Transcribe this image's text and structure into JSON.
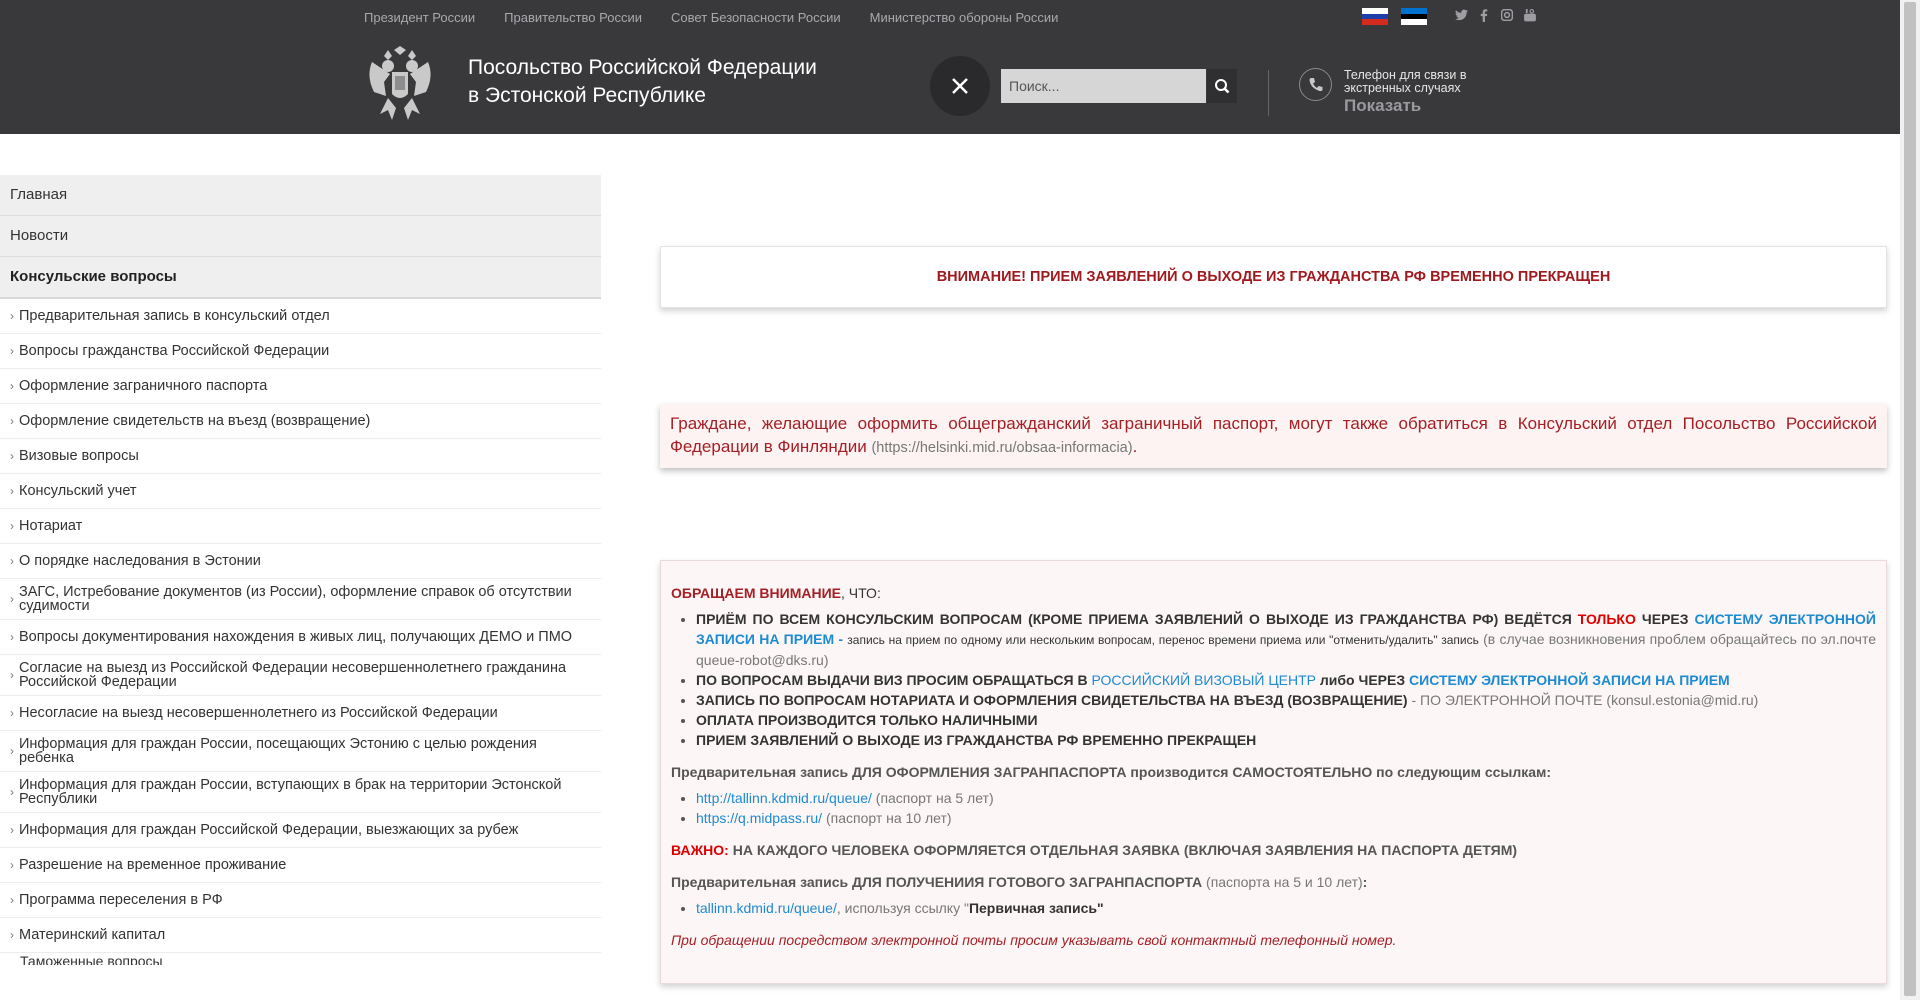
{
  "top_links": [
    "Президент России",
    "Правительство России",
    "Совет Безопасности России",
    "Министерство обороны России"
  ],
  "social": [
    "twitter-icon",
    "facebook-icon",
    "instagram-icon",
    "youtube-icon"
  ],
  "header": {
    "title_line1": "Посольство Российской Федерации",
    "title_line2": "в Эстонской Республике",
    "search_placeholder": "Поиск...",
    "phone_line1": "Телефон для связи в",
    "phone_line2": "экстренных случаях",
    "phone_show": "Показать"
  },
  "colors": {
    "header_bg": "#39393b",
    "accent_red": "#a52026",
    "link_blue": "#1d8bd1"
  },
  "sidebar": {
    "top": [
      "Главная",
      "Новости",
      "Консульские вопросы"
    ],
    "items": [
      "Предварительная запись в консульский отдел",
      "Вопросы гражданства Российской Федерации",
      "Оформление заграничного паспорта",
      "Оформление свидетельств на въезд (возвращение)",
      "Визовые вопросы",
      "Консульский учет",
      "Нотариат",
      "О порядке наследования в Эстонии",
      "ЗАГС, Истребование документов (из России), оформление справок об отсутствии судимости",
      "Вопросы документирования нахождения в живых лиц, получающих ДЕМО и ПМО",
      "Согласие на выезд из Российской Федерации несовершеннолетнего гражданина Российской Федерации",
      "Несогласие на выезд несовершеннолетнего из Российской Федерации",
      "Информация для граждан России, посещающих Эстонию с целью рождения ребенка",
      "Информация для граждан России, вступающих в брак на территории Эстонской Республики",
      "Информация для граждан Российской Федерации, выезжающих за рубеж",
      "Разрешение на временное проживание",
      "Программа переселения в РФ",
      "Материнский капитал"
    ],
    "cut_item": "Таможенные вопросы"
  },
  "notice": "ВНИМАНИЕ! ПРИЕМ ЗАЯВЛЕНИЙ О ВЫХОДЕ ИЗ ГРАЖДАНСТВА РФ ВРЕМЕННО ПРЕКРАЩЕН",
  "finland": {
    "text": "Граждане, желающие оформить общегражданский заграничный паспорт, могут также обратиться в Консульский отдел Посольство Российской Федерации в Финляндии",
    "url": "(https://helsinki.mid.ru/obsaa-informacia)",
    "dot": "."
  },
  "info": {
    "heading_red": "ОБРАЩАЕМ ВНИМАНИЕ",
    "heading_rest": ", ЧТО:",
    "b1_a": "ПРИЁМ ПО ВСЕМ КОНСУЛЬСКИМ ВОПРОСАМ (КРОМЕ ПРИЕМА ЗАЯВЛЕНИЙ О ВЫХОДЕ ИЗ ГРАЖДАНСТВА РФ) ВЕДЁТСЯ ",
    "b1_only": "ТОЛЬКО",
    "b1_through": " ЧЕРЕЗ ",
    "b1_link": "СИСТЕМУ ЭЛЕКТРОННОЙ ЗАПИСИ НА ПРИЕМ",
    "b1_dash": " - ",
    "b1_small": "запись на прием по одному или нескольким вопросам, перенос времени приема или \"отменить/удалить\" запись",
    "b1_gray": " (в случае возникновения проблем обращайтесь по эл.почте queue-robot@dks.ru)",
    "b2_a": "ПО ВОПРОСАМ ВЫДАЧИ ВИЗ ПРОСИМ ОБРАЩАТЬСЯ В ",
    "b2_link1": "РОССИЙСКИЙ ВИЗОВЫЙ ЦЕНТР",
    "b2_mid": " либо ЧЕРЕЗ ",
    "b2_link2": "СИСТЕМУ ЭЛЕКТРОННОЙ ЗАПИСИ НА ПРИЕМ",
    "b3_a": "ЗАПИСЬ ПО ВОПРОСАМ НОТАРИАТА И ОФОРМЛЕНИЯ СВИДЕТЕЛЬСТВА НА ВЪЕЗД (ВОЗВРАЩЕНИЕ)",
    "b3_b": " - ПО ЭЛЕКТРОННОЙ ПОЧТЕ (konsul.estonia@mid.ru)",
    "b4": "ОПЛАТА ПРОИЗВОДИТСЯ ТОЛЬКО НАЛИЧНЫМИ",
    "b5": "ПРИЕМ ЗАЯВЛЕНИЙ О ВЫХОДЕ ИЗ ГРАЖДАНСТВА РФ ВРЕМЕННО ПРЕКРАЩЕН",
    "prelim1": "Предварительная запись ДЛЯ ОФОРМЛЕНИЯ ЗАГРАНПАСПОРТА производится САМОСТОЯТЕЛЬНО по следующим ссылкам:",
    "link1": "http://tallinn.kdmid.ru/queue/",
    "link1_note": " (паспорт на 5 лет)",
    "link2": "https://q.midpass.ru/",
    "link2_note": " (паспорт на 10 лет)",
    "important_red": "ВАЖНО:",
    "important_rest": " НА КАЖДОГО ЧЕЛОВЕКА ОФОРМЛЯЕТСЯ ОТДЕЛЬНАЯ ЗАЯВКА (ВКЛЮЧАЯ ЗАЯВЛЕНИЯ НА ПАСПОРТА ДЕТЯМ)",
    "prelim2_a": "Предварительная запись ДЛЯ ПОЛУЧЕНИИЯ ГОТОВОГО ЗАГРАНПАСПОРТА",
    "prelim2_b": " (паспорта на 5 и 10 лет)",
    "prelim2_c": ":",
    "link3": "tallinn.kdmid.ru/queue/",
    "link3_note": ", используя ссылку \"",
    "link3_bold": "Первичная запись",
    "link3_end": "\"",
    "footer_italic": "При обращении посредством электронной почты просим указывать свой контактный телефонный номер."
  }
}
